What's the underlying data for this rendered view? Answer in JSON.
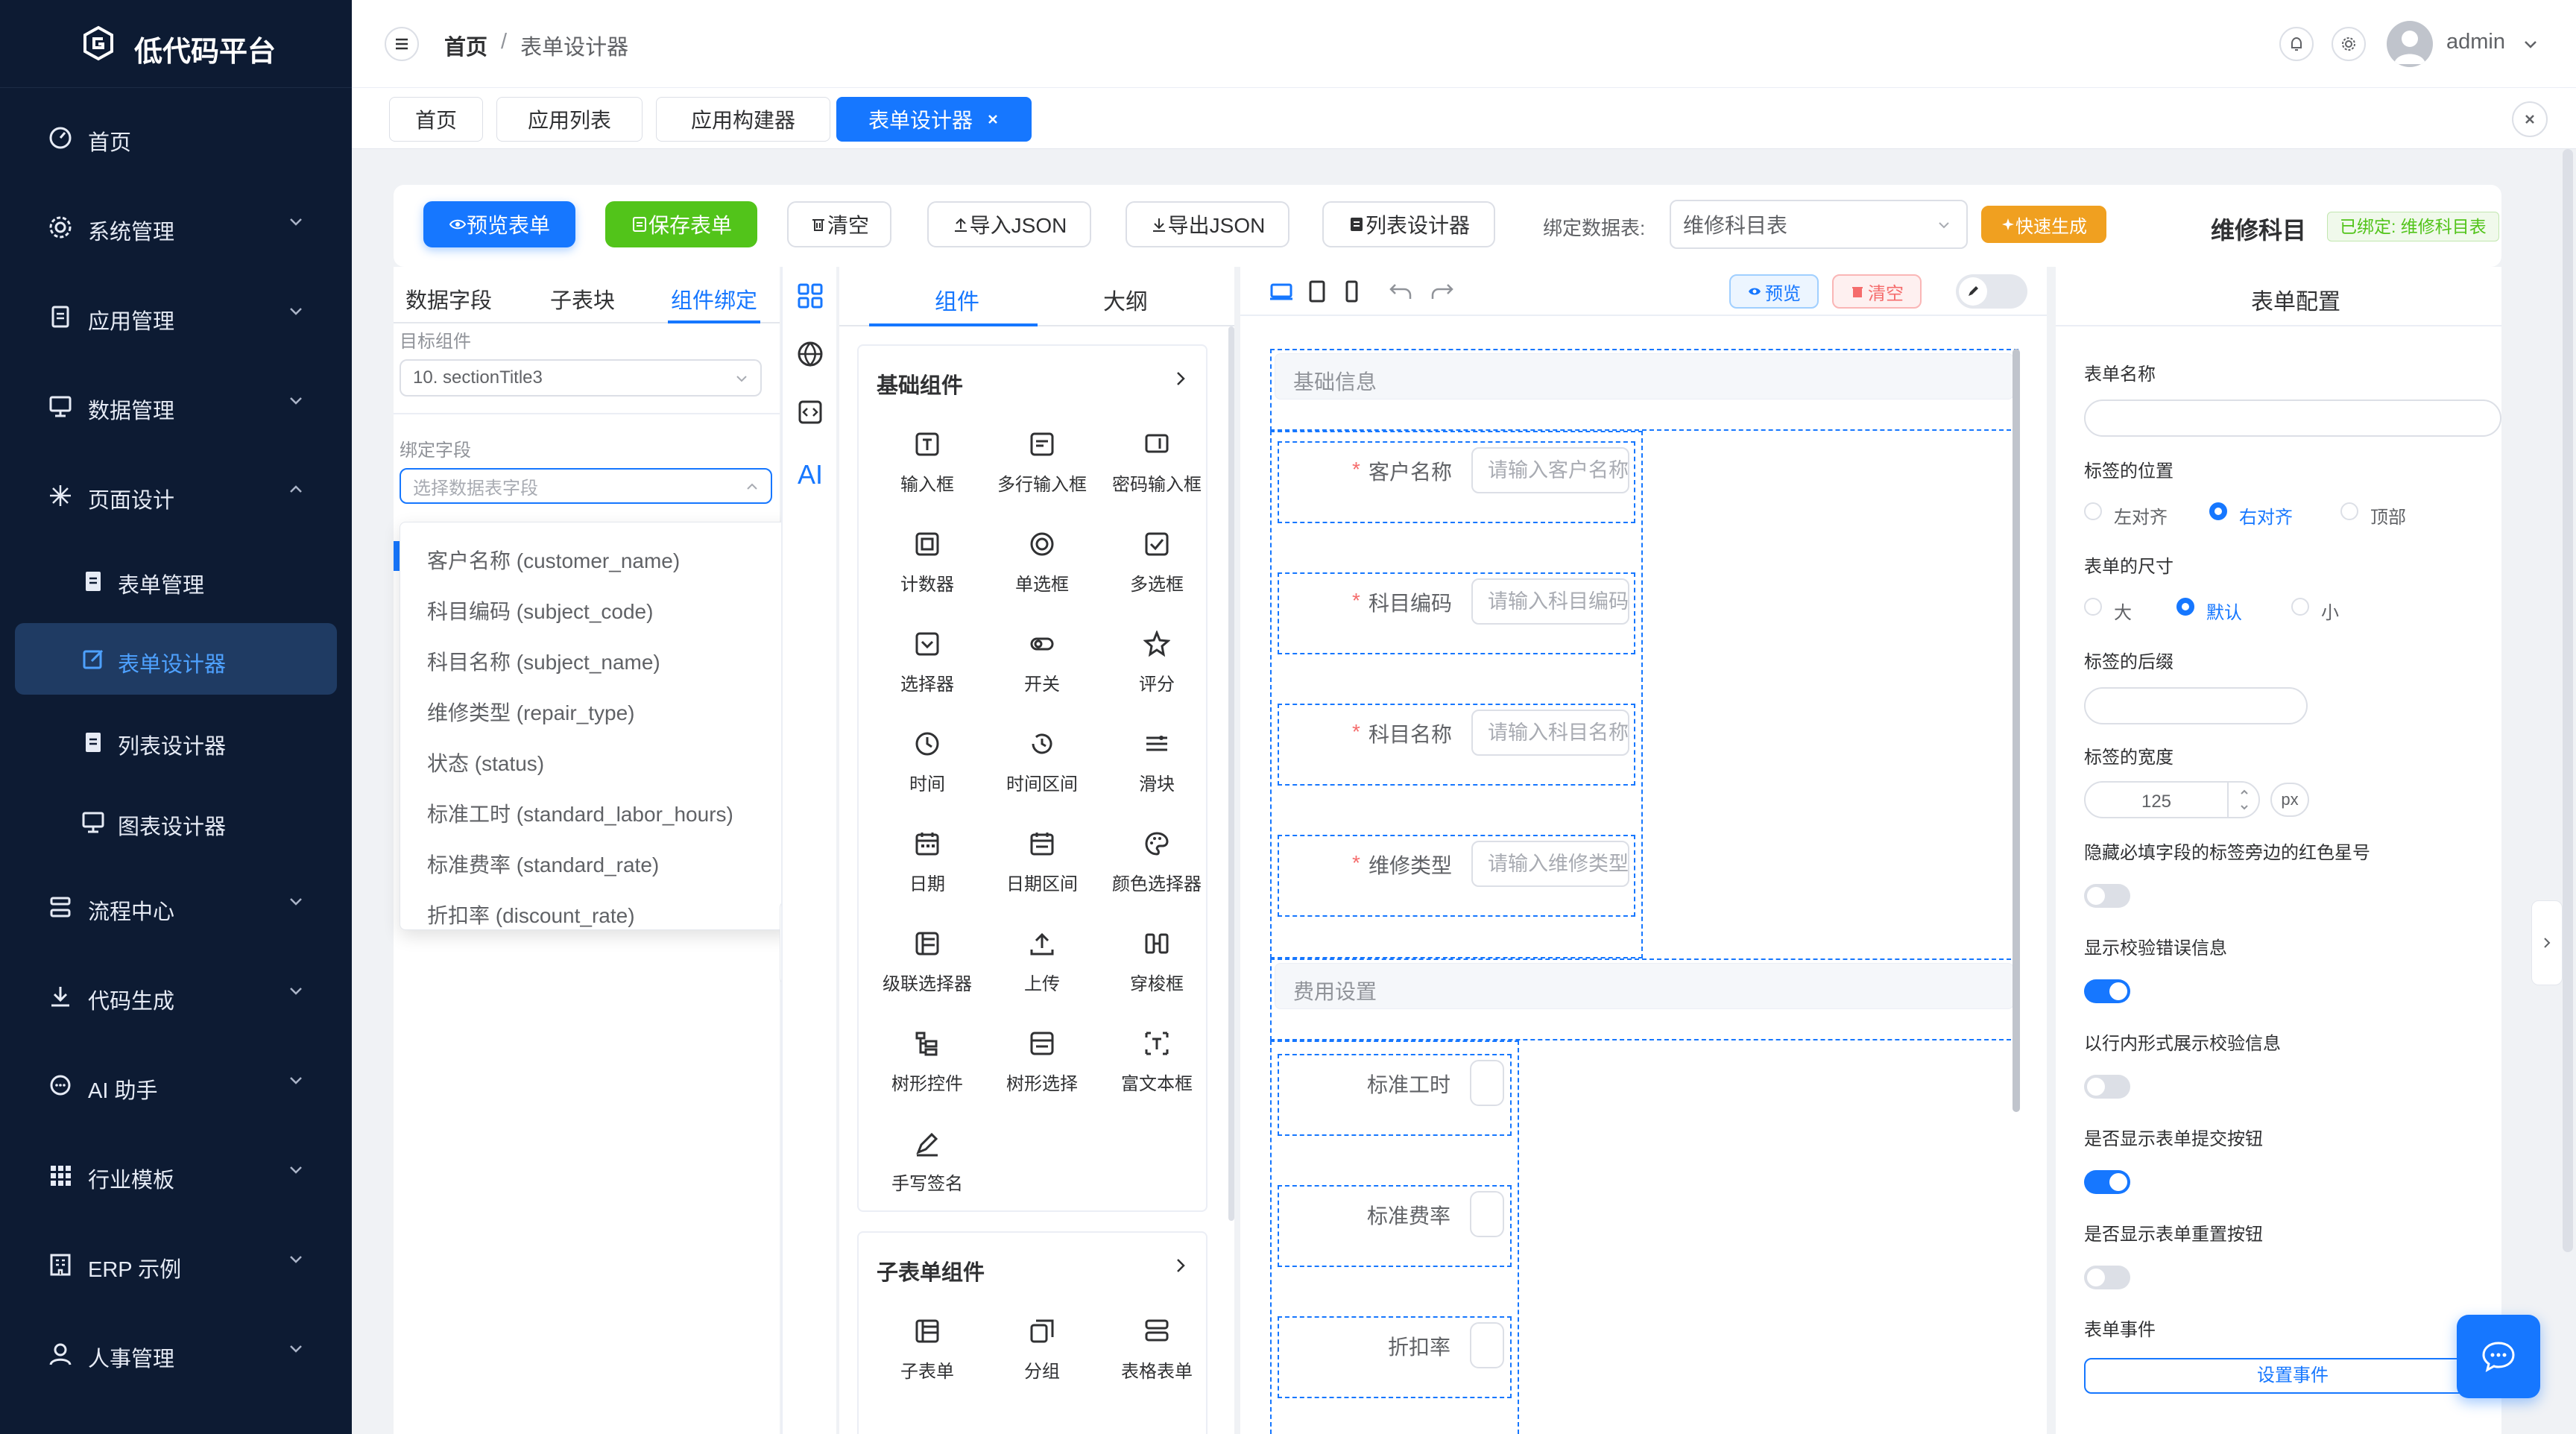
{
  "app": {
    "title": "低代码平台"
  },
  "sidebar": {
    "items": [
      {
        "label": "首页"
      },
      {
        "label": "系统管理"
      },
      {
        "label": "应用管理"
      },
      {
        "label": "数据管理"
      },
      {
        "label": "页面设计"
      },
      {
        "label": "表单管理"
      },
      {
        "label": "表单设计器"
      },
      {
        "label": "列表设计器"
      },
      {
        "label": "图表设计器"
      },
      {
        "label": "流程中心"
      },
      {
        "label": "代码生成"
      },
      {
        "label": "AI 助手"
      },
      {
        "label": "行业模板"
      },
      {
        "label": "ERP 示例"
      },
      {
        "label": "人事管理"
      }
    ]
  },
  "header": {
    "breadcrumb": [
      "首页",
      "/",
      "表单设计器"
    ],
    "user": "admin"
  },
  "tabs": [
    "首页",
    "应用列表",
    "应用构建器",
    "表单设计器"
  ],
  "toolbar": {
    "preview": "预览表单",
    "save": "保存表单",
    "clear": "清空",
    "import": "导入JSON",
    "export": "导出JSON",
    "list_designer": "列表设计器",
    "bind_label": "绑定数据表:",
    "bind_value": "维修科目表",
    "quick": "快速生成",
    "title": "维修科目",
    "bound_badge": "已绑定: 维修科目表"
  },
  "left_panel": {
    "tabs": [
      "数据字段",
      "子表块",
      "组件绑定"
    ],
    "target_label": "目标组件",
    "target_value": "10. sectionTitle3",
    "bind_field_label": "绑定字段",
    "bind_field_placeholder": "选择数据表字段",
    "options": [
      "客户名称 (customer_name)",
      "科目编码 (subject_code)",
      "科目名称 (subject_name)",
      "维修类型 (repair_type)",
      "状态 (status)",
      "标准工时 (standard_labor_hours)",
      "标准费率 (standard_rate)",
      "折扣率 (discount_rate)"
    ]
  },
  "rail": {
    "ai": "AI"
  },
  "components_panel": {
    "tabs": [
      "组件",
      "大纲"
    ],
    "basic_title": "基础组件",
    "basic": [
      "输入框",
      "多行输入框",
      "密码输入框",
      "计数器",
      "单选框",
      "多选框",
      "选择器",
      "开关",
      "评分",
      "时间",
      "时间区间",
      "滑块",
      "日期",
      "日期区间",
      "颜色选择器",
      "级联选择器",
      "上传",
      "穿梭框",
      "树形控件",
      "树形选择",
      "富文本框",
      "手写签名"
    ],
    "sub_title": "子表单组件",
    "sub": [
      "子表单",
      "分组",
      "表格表单"
    ]
  },
  "canvas": {
    "preview": "预览",
    "clear": "清空",
    "section1": "基础信息",
    "fields1": [
      {
        "label": "客户名称",
        "placeholder": "请输入客户名称"
      },
      {
        "label": "科目编码",
        "placeholder": "请输入科目编码"
      },
      {
        "label": "科目名称",
        "placeholder": "请输入科目名称"
      },
      {
        "label": "维修类型",
        "placeholder": "请输入维修类型"
      }
    ],
    "required_mark": "*",
    "section2": "费用设置",
    "fields2": [
      {
        "label": "标准工时"
      },
      {
        "label": "标准费率"
      },
      {
        "label": "折扣率"
      }
    ]
  },
  "config": {
    "title": "表单配置",
    "form_name_label": "表单名称",
    "label_pos_label": "标签的位置",
    "label_pos_opts": [
      "左对齐",
      "右对齐",
      "顶部"
    ],
    "label_pos_selected": "右对齐",
    "size_label": "表单的尺寸",
    "size_opts": [
      "大",
      "默认",
      "小"
    ],
    "size_selected": "默认",
    "suffix_label": "标签的后缀",
    "width_label": "标签的宽度",
    "width_value": "125",
    "width_unit": "px",
    "hide_star_label": "隐藏必填字段的标签旁边的红色星号",
    "hide_star_on": false,
    "show_err_label": "显示校验错误信息",
    "show_err_on": true,
    "inline_err_label": "以行内形式展示校验信息",
    "inline_err_on": false,
    "show_submit_label": "是否显示表单提交按钮",
    "show_submit_on": true,
    "show_reset_label": "是否显示表单重置按钮",
    "show_reset_on": false,
    "events_label": "表单事件",
    "set_events": "设置事件"
  },
  "colors": {
    "primary": "#1677ff",
    "sidebar": "#0d1b33",
    "green": "#52c41a",
    "orange": "#f0a020"
  }
}
